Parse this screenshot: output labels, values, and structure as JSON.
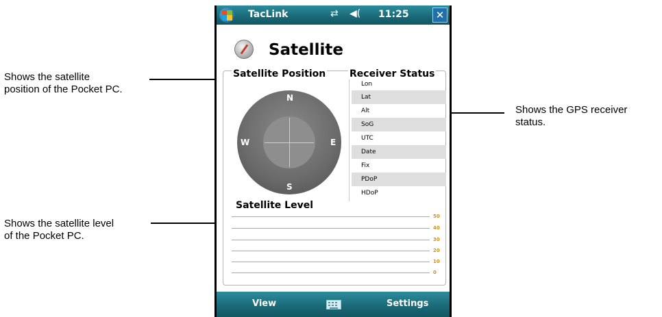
{
  "callouts": {
    "satellite_position": [
      "Shows the satellite",
      "position of the Pocket PC."
    ],
    "receiver_status": [
      "Shows the GPS receiver",
      "status."
    ],
    "satellite_level": [
      "Shows the satellite level",
      "of the Pocket PC."
    ]
  },
  "titlebar": {
    "app_title": "TacLink",
    "clock": "11:25",
    "close_label": "✕",
    "connectivity_icon": "⇄",
    "volume_icon": "◀("
  },
  "page": {
    "title": "Satellite"
  },
  "satellite_position": {
    "label": "Satellite Position",
    "directions": {
      "n": "N",
      "s": "S",
      "e": "E",
      "w": "W"
    }
  },
  "receiver_status": {
    "label": "Receiver Status",
    "rows": [
      "Lon",
      "Lat",
      "Alt",
      "SoG",
      "UTC",
      "Date",
      "Fix",
      "PDoP",
      "HDoP"
    ]
  },
  "satellite_level": {
    "label": "Satellite Level",
    "ticks": [
      "50",
      "40",
      "30",
      "20",
      "10",
      "0"
    ]
  },
  "bottombar": {
    "left_key": "View",
    "right_key": "Settings"
  },
  "colors": {
    "bar_teal": "#1a6876",
    "tick_orange": "#e08a00",
    "row_shade": "#dedede"
  }
}
